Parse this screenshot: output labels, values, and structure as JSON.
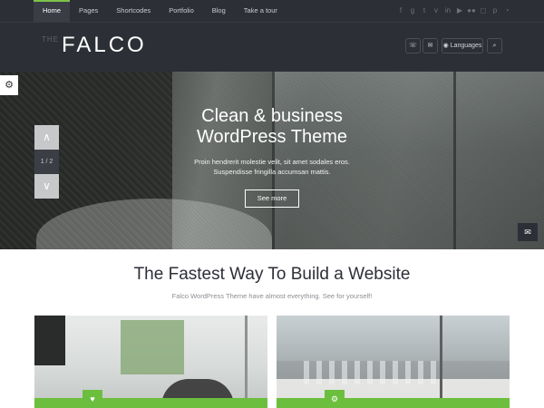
{
  "nav": {
    "items": [
      {
        "label": "Home"
      },
      {
        "label": "Pages"
      },
      {
        "label": "Shortcodes"
      },
      {
        "label": "Portfolio"
      },
      {
        "label": "Blog"
      },
      {
        "label": "Take a tour"
      }
    ],
    "active_index": 0,
    "social_icons": [
      "facebook-icon",
      "google-plus-icon",
      "twitter-icon",
      "vimeo-icon",
      "linkedin-icon",
      "youtube-icon",
      "flickr-icon",
      "instagram-icon",
      "pinterest-icon",
      "rss-icon"
    ]
  },
  "header": {
    "logo_prefix": "THE",
    "logo_text": "FALCO",
    "phone_icon": "☏",
    "mail_icon": "✉",
    "languages_label": "◉ Languages",
    "search_icon": "⌕"
  },
  "hero": {
    "title_line1": "Clean & business",
    "title_line2": "WordPress Theme",
    "text_line1": "Proin hendrerit molestie velit, sit amet sodales eros.",
    "text_line2": "Suspendisse fringilla accumsan mattis.",
    "button_label": "See more",
    "counter": "1 / 2",
    "up_icon": "∧",
    "down_icon": "∨",
    "gear_icon": "⚙",
    "mail_icon": "✉"
  },
  "section": {
    "title": "The Fastest Way To Build a Website",
    "subtitle": "Falco WordPress Theme have almost everything. See for yourself!"
  },
  "cards": [
    {
      "badge_icon": "♥"
    },
    {
      "badge_icon": "⚙"
    }
  ],
  "colors": {
    "accent": "#6cbf3e",
    "dark": "#2d2f37",
    "nav_active_border": "#7ec24a"
  }
}
